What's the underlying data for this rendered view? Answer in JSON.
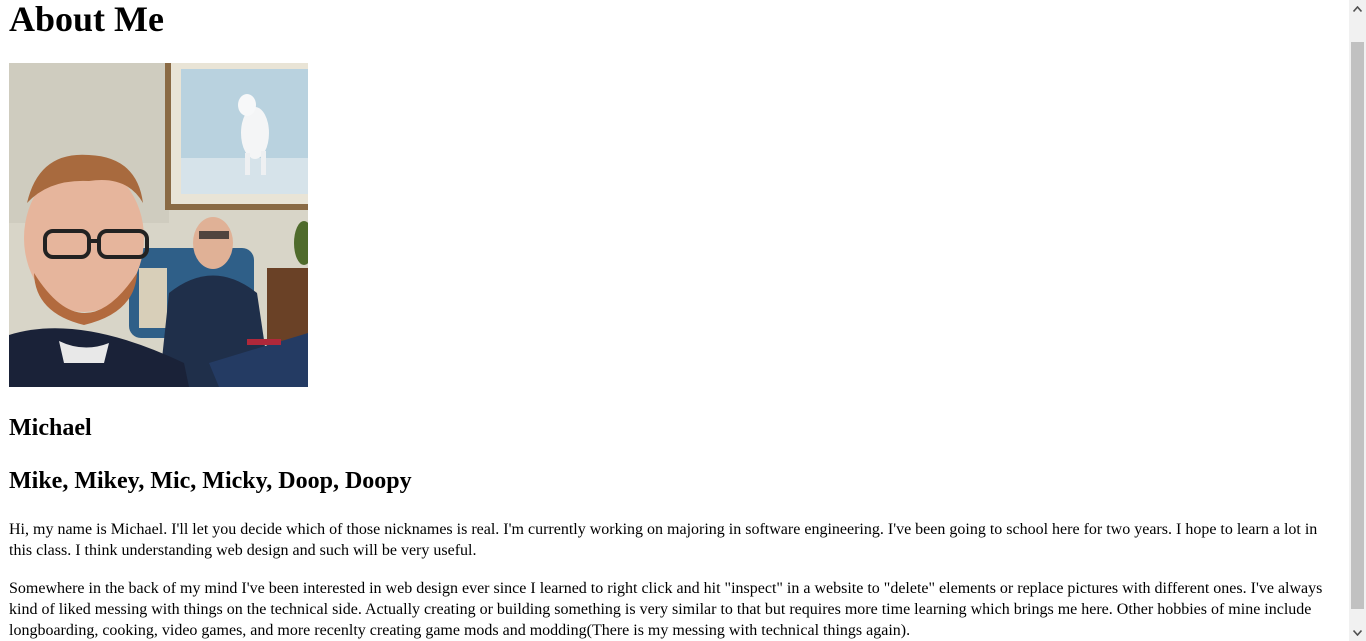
{
  "page": {
    "title": "About Me",
    "photo_alt": "Selfie of two men in a living room",
    "name": "Michael",
    "nicknames": "Mike, Mikey, Mic, Micky, Doop, Doopy",
    "paragraphs": [
      "Hi, my name is Michael. I'll let you decide which of those nicknames is real. I'm currently working on majoring in software engineering. I've been going to school here for two years. I hope to learn a lot in this class. I think understanding web design and such will be very useful.",
      "Somewhere in the back of my mind I've been interested in web design ever since I learned to right click and hit \"inspect\" in a website to \"delete\" elements or replace pictures with different ones. I've always kind of liked messing with things on the technical side. Actually creating or building something is very similar to that but requires more time learning which brings me here. Other hobbies of mine include longboarding, cooking, video games, and more recenlty creating game mods and modding(There is my messing with technical things again)."
    ]
  },
  "scrollbar": {
    "up_icon": "chevron-up-icon",
    "down_icon": "chevron-down-icon"
  },
  "colors": {
    "background": "#ffffff",
    "text": "#000000",
    "scroll_track": "#f1f1f1",
    "scroll_thumb": "#c1c1c1"
  }
}
